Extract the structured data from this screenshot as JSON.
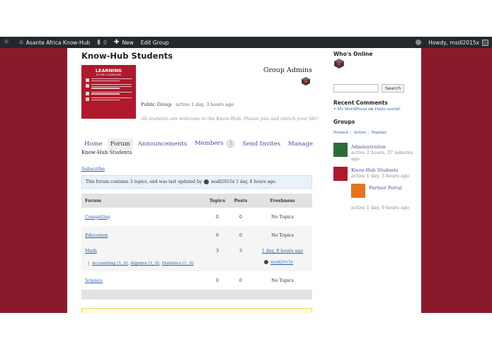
{
  "admin_bar": {
    "wp_logo": "wordpress-icon",
    "site_name": "Asante Africa Know-Hub",
    "comments_count": "0",
    "new_label": "New",
    "edit_group_label": "Edit Group",
    "howdy": "Howdy, msdl2015x"
  },
  "group": {
    "title": "Know-Hub Students",
    "avatar": {
      "title": "LEARNING",
      "subtitle": "IN THE CLASSROOM"
    },
    "admins_label": "Group Admins",
    "type": "Public Group",
    "activity": "active 1 day, 3 hours ago",
    "description": "All students are welcome to the Know-Hub. Please join and enrich your life!"
  },
  "tabs": [
    {
      "label": "Home"
    },
    {
      "label": "Forum"
    },
    {
      "label": "Announcements"
    },
    {
      "label": "Members",
      "count": "1"
    },
    {
      "label": "Send Invites"
    },
    {
      "label": "Manage"
    }
  ],
  "forum_page": {
    "subnav_label": "Know-Hub Students",
    "subscribe": "Subscribe",
    "info_prefix": "This forum contains 3 topics, and was last updated by",
    "info_user": "msdl2015x",
    "info_suffix": "1 day, 8 hours ago.",
    "headers": {
      "forum": "Forum",
      "topics": "Topics",
      "posts": "Posts",
      "freshness": "Freshness"
    },
    "rows": [
      {
        "name": "Computing",
        "topics": "0",
        "posts": "0",
        "freshness": "No Topics"
      },
      {
        "name": "Education",
        "topics": "0",
        "posts": "0",
        "freshness": "No Topics"
      },
      {
        "name": "Math",
        "topics": "3",
        "posts": "3",
        "freshness": "1 day, 8 hours ago",
        "subforums": [
          "Accounting (1, 0)",
          "Algebra (1, 0)",
          "Statistics (1, 0)"
        ],
        "author": "msdl2015x"
      },
      {
        "name": "Science",
        "topics": "0",
        "posts": "0",
        "freshness": "No Topics"
      }
    ]
  },
  "sidebar": {
    "whos_online": "Who's Online",
    "search_button": "Search",
    "recent_comments": "Recent Comments",
    "recent_author": "Mr WordPress",
    "recent_on": "on",
    "recent_post": "Hello world!",
    "groups_title": "Groups",
    "filters": [
      "Newest",
      "Active",
      "Popular"
    ],
    "groups": [
      {
        "name": "Administration",
        "activity": "active 2 hours, 37 minutes ago"
      },
      {
        "name": "Know-Hub Students",
        "activity": "active 1 day, 3 hours ago"
      },
      {
        "name": "Partner Portal",
        "activity": "active 1 day, 9 hours ago"
      }
    ]
  },
  "colors": {
    "maroon": "#8a1a2b",
    "link": "#2a5db0",
    "tab": "#5b3fa6",
    "admin_bar": "#23282d"
  }
}
